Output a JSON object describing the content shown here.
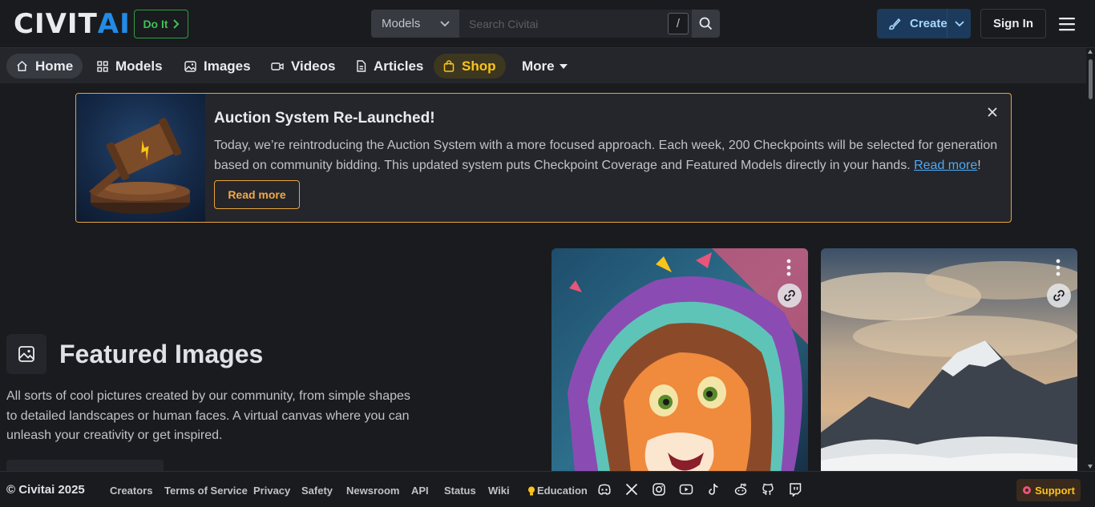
{
  "header": {
    "logo_civ": "CIVIT",
    "logo_ai": "AI",
    "doit_label": "Do It",
    "search_scope": "Models",
    "search_placeholder": "Search Civitai",
    "search_shortcut": "/",
    "create_label": "Create",
    "signin_label": "Sign In"
  },
  "nav": {
    "items": [
      {
        "label": "Home",
        "icon": "home-icon"
      },
      {
        "label": "Models",
        "icon": "grid-icon"
      },
      {
        "label": "Images",
        "icon": "image-icon"
      },
      {
        "label": "Videos",
        "icon": "video-icon"
      },
      {
        "label": "Articles",
        "icon": "article-icon"
      },
      {
        "label": "Shop",
        "icon": "shopping-bag-icon"
      },
      {
        "label": "More",
        "icon": "caret-down-icon"
      }
    ]
  },
  "banner": {
    "title": "Auction System Re-Launched!",
    "text": "Today, we’re reintroducing the Auction System with a more focused approach. Each week, 200 Checkpoints will be selected for generation based on community bidding. This updated system puts Checkpoint Coverage and Featured Models directly in your hands.",
    "link_text": "Read more",
    "link_suffix": "!",
    "button_label": "Read more"
  },
  "featured": {
    "title": "Featured Images",
    "description": "All sorts of cool pictures created by our community, from simple shapes to detailed landscapes or human faces. A virtual canvas where you can unleash your creativity or get inspired."
  },
  "footer": {
    "copyright": "© Civitai 2025",
    "links": [
      "Creators",
      "Terms of Service",
      "Privacy",
      "Safety",
      "Newsroom",
      "API",
      "Status",
      "Wiki",
      "Education"
    ],
    "social_icons": [
      "discord-icon",
      "x-icon",
      "instagram-icon",
      "youtube-icon",
      "tiktok-icon",
      "reddit-icon",
      "github-icon",
      "twitch-icon"
    ],
    "support_label": "Support"
  },
  "colors": {
    "background": "#1a1b1e",
    "nav_background": "#25262b",
    "accent_blue": "#228be6",
    "banner_border": "#e8a33c",
    "shop_yellow": "#fcc419",
    "doit_green": "#40c057"
  }
}
